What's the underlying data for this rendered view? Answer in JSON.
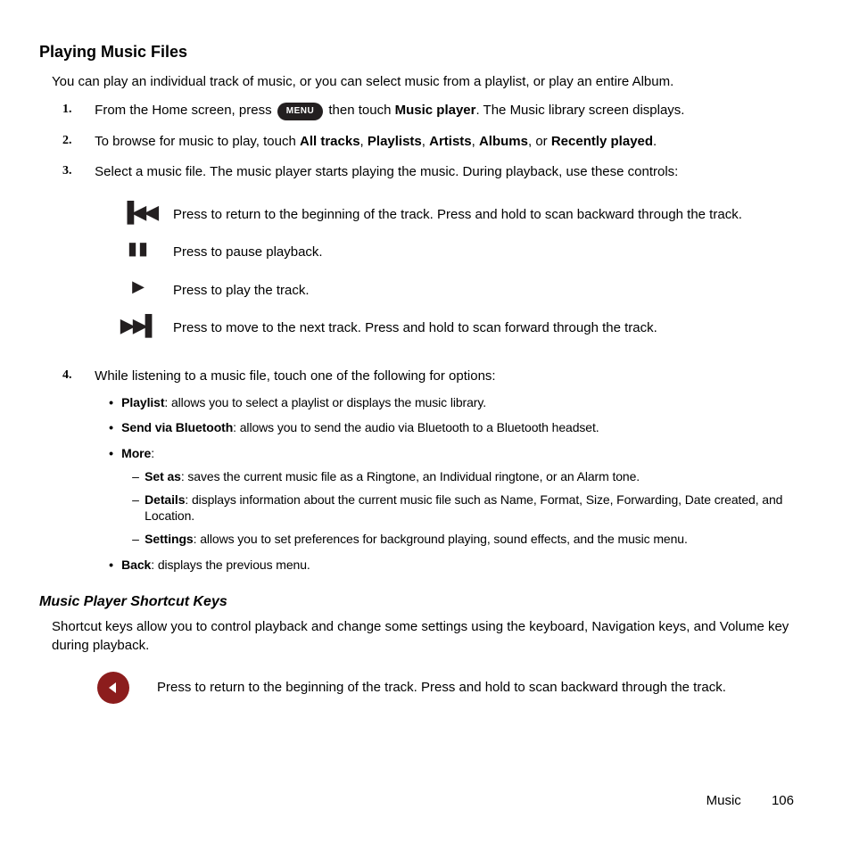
{
  "section_title": "Playing Music Files",
  "intro": "You can play an individual track of music, or you can select music from a playlist, or play an entire Album.",
  "menu_label": "MENU",
  "steps": {
    "1": {
      "num": "1.",
      "pre": "From the Home screen, press ",
      "post": " then touch ",
      "bold1": "Music player",
      "tail": ". The Music library screen displays."
    },
    "2": {
      "num": "2.",
      "pre": "To browse for music to play, touch ",
      "b1": "All tracks",
      "c1": ", ",
      "b2": "Playlists",
      "c2": ", ",
      "b3": "Artists",
      "c3": ", ",
      "b4": "Albums",
      "c4": ", or ",
      "b5": "Recently played",
      "tail": "."
    },
    "3": {
      "num": "3.",
      "text": "Select a music file. The music player starts playing the music. During playback, use these controls:"
    },
    "4": {
      "num": "4.",
      "text": "While listening to a music file, touch one of the following for options:"
    }
  },
  "controls": {
    "prev": "Press to return to the beginning of the track. Press and hold to scan backward through the track.",
    "pause": "Press to pause playback.",
    "play": "Press to play the track.",
    "next": "Press to move to the next track. Press and hold to scan forward through the track."
  },
  "options": {
    "playlist": {
      "name": "Playlist",
      "desc": ": allows you to select a playlist or displays the music library."
    },
    "sendbt": {
      "name": "Send via Bluetooth",
      "desc": ": allows you to send the audio via Bluetooth to a Bluetooth headset."
    },
    "more": {
      "name": "More",
      "desc": ":"
    },
    "setas": {
      "name": "Set as",
      "desc": ": saves the current music file as a Ringtone, an Individual ringtone, or an Alarm tone."
    },
    "details": {
      "name": "Details",
      "desc": ": displays information about the current music file such as Name, Format, Size, Forwarding, Date created, and Location."
    },
    "settings": {
      "name": "Settings",
      "desc": ": allows you to set preferences for background playing, sound effects, and the music menu."
    },
    "back": {
      "name": "Back",
      "desc": ": displays the previous menu."
    }
  },
  "subsection_title": "Music Player Shortcut Keys",
  "shortcut_intro": "Shortcut keys allow you to control playback and change some settings using the keyboard, Navigation keys, and Volume key during playback.",
  "shortcut": {
    "left": "Press to return to the beginning of the track. Press and hold to scan backward through the track."
  },
  "footer": {
    "section": "Music",
    "page": "106"
  }
}
